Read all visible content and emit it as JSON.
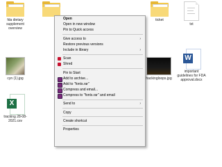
{
  "files": [
    {
      "name": "fda dietary supplement overview",
      "type": "folder"
    },
    {
      "name": "",
      "type": "folder"
    },
    {
      "name": "ticket",
      "type": "folder"
    },
    {
      "name": "txt",
      "type": "document"
    },
    {
      "name": "cyn (1).jpg",
      "type": "image"
    },
    {
      "name": "hackingloops.jpg",
      "type": "image"
    },
    {
      "name": "important guidelines for FDA approval.docx",
      "type": "word"
    },
    {
      "name": "tracking 28-08-2021.csv",
      "type": "excel"
    }
  ],
  "context_menu": {
    "items": [
      {
        "label": "Open",
        "bold": true
      },
      {
        "label": "Open in new window"
      },
      {
        "label": "Pin to Quick access"
      },
      {
        "separator": true
      },
      {
        "label": "Give access to",
        "submenu": true
      },
      {
        "label": "Restore previous versions"
      },
      {
        "label": "Include in library",
        "submenu": true
      },
      {
        "separator": true
      },
      {
        "label": "Scan",
        "icon": "mcafee-icon"
      },
      {
        "label": "Shred",
        "icon": "mcafee-icon"
      },
      {
        "separator": true
      },
      {
        "label": "Pin to Start"
      },
      {
        "label": "Add to archive...",
        "icon": "winrar-icon"
      },
      {
        "label": "Add to \"fonts.rar\"",
        "icon": "winrar-icon"
      },
      {
        "label": "Compress and email...",
        "icon": "winrar-icon"
      },
      {
        "label": "Compress to \"fonts.rar\" and email",
        "icon": "winrar-icon"
      },
      {
        "separator": true
      },
      {
        "label": "Send to",
        "submenu": true
      },
      {
        "separator": true
      },
      {
        "label": "Copy"
      },
      {
        "separator": true
      },
      {
        "label": "Create shortcut"
      },
      {
        "separator": true
      },
      {
        "label": "Properties"
      }
    ],
    "submenu_glyph": "›"
  },
  "colors": {
    "folder": "#f3c94b",
    "word": "#2b5797",
    "excel": "#1d7044",
    "mcafee": "#c8102e",
    "winrar": "#7a2a7a",
    "menu_bg": "#f2f2f2"
  }
}
